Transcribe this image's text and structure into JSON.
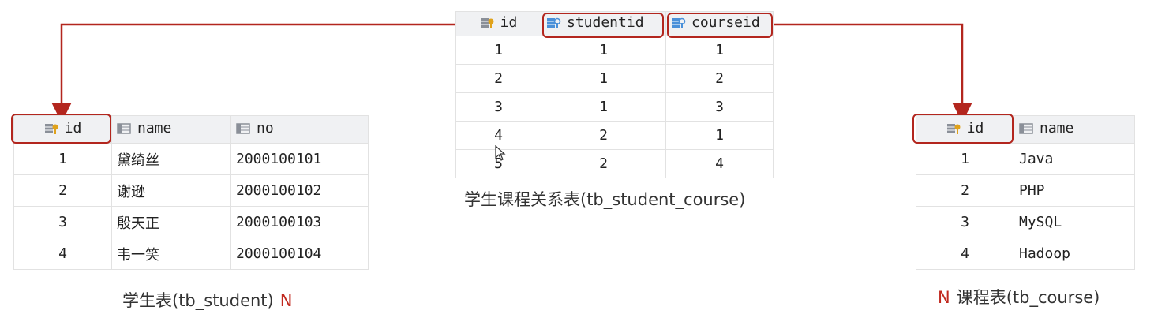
{
  "student_table": {
    "headers": [
      "id",
      "name",
      "no"
    ],
    "rows": [
      [
        "1",
        "黛绮丝",
        "2000100101"
      ],
      [
        "2",
        "谢逊",
        "2000100102"
      ],
      [
        "3",
        "殷天正",
        "2000100103"
      ],
      [
        "4",
        "韦一笑",
        "2000100104"
      ]
    ],
    "caption": "学生表(tb_student)",
    "multiplicity": "N"
  },
  "relation_table": {
    "headers": [
      "id",
      "studentid",
      "courseid"
    ],
    "rows": [
      [
        "1",
        "1",
        "1"
      ],
      [
        "2",
        "1",
        "2"
      ],
      [
        "3",
        "1",
        "3"
      ],
      [
        "4",
        "2",
        "1"
      ],
      [
        "5",
        "2",
        "4"
      ]
    ],
    "caption": "学生课程关系表(tb_student_course)"
  },
  "course_table": {
    "headers": [
      "id",
      "name"
    ],
    "rows": [
      [
        "1",
        "Java"
      ],
      [
        "2",
        "PHP"
      ],
      [
        "3",
        "MySQL"
      ],
      [
        "4",
        "Hadoop"
      ]
    ],
    "caption": "课程表(tb_course)",
    "multiplicity": "N"
  },
  "colors": {
    "highlight": "#b3261e",
    "multiplicity": "#c0281e",
    "header_bg": "#f0f1f3"
  },
  "icons": {
    "primary_key": "key-column-icon",
    "foreign_key": "foreign-key-column-icon",
    "column": "column-icon"
  }
}
